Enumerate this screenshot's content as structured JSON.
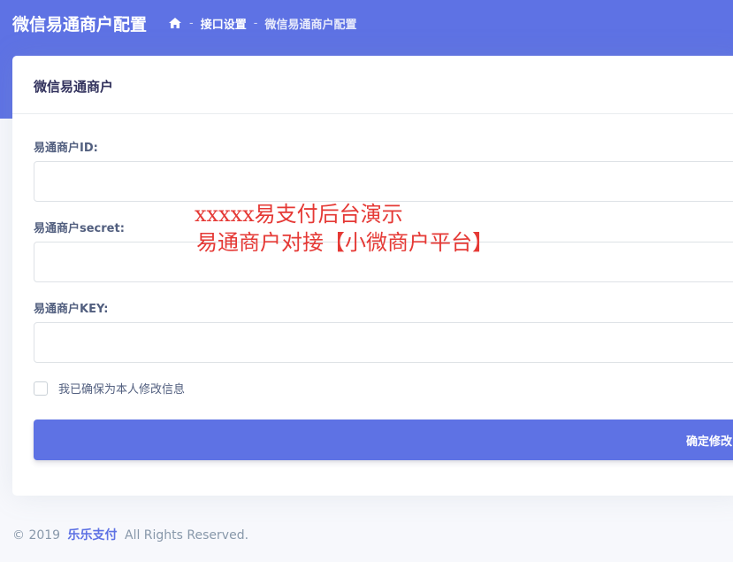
{
  "header": {
    "title": "微信易通商户配置",
    "breadcrumb": {
      "home_icon": "home-icon",
      "separator": "-",
      "level1": "接口设置",
      "current": "微信易通商户配置"
    }
  },
  "card": {
    "title": "微信易通商户",
    "fields": {
      "merchant_id": {
        "label": "易通商户ID:",
        "value": ""
      },
      "merchant_secret": {
        "label": "易通商户secret:",
        "value": ""
      },
      "merchant_key": {
        "label": "易通商户KEY:",
        "value": ""
      }
    },
    "confirm_checkbox": {
      "label": "我已确保为本人修改信息",
      "checked": false
    },
    "submit_label": "确定修改"
  },
  "overlay": {
    "line1": "xxxxx易支付后台演示",
    "line2": "易通商户对接【小微商户平台】",
    "color": "#e53935"
  },
  "footer": {
    "prefix": "© 2019",
    "brand": "乐乐支付",
    "suffix": "All Rights Reserved."
  },
  "colors": {
    "primary": "#5e72e4",
    "background": "#f7f8fc"
  }
}
